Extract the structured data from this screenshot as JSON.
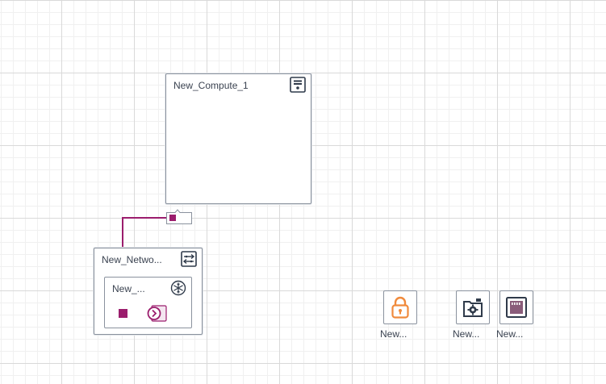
{
  "canvas": {
    "grid": true
  },
  "compute_node": {
    "title": "New_Compute_1",
    "icon": "server-icon"
  },
  "network_node": {
    "title": "New_Netwo...",
    "icon": "network-switch-icon",
    "subnet": {
      "title": "New_...",
      "icon": "snowflake-icon",
      "port_icon": "port-arrow-icon"
    }
  },
  "floating_nodes": [
    {
      "label": "New...",
      "icon": "padlock-icon"
    },
    {
      "label": "New...",
      "icon": "folder-gear-icon"
    },
    {
      "label": "New...",
      "icon": "ethernet-port-icon"
    }
  ],
  "colors": {
    "link": "#9b1d6d",
    "node_border": "#8a929e",
    "lock_accent": "#f08a3c",
    "ethernet_accent": "#8a5c7a",
    "dark_icon": "#2f3a4a"
  }
}
